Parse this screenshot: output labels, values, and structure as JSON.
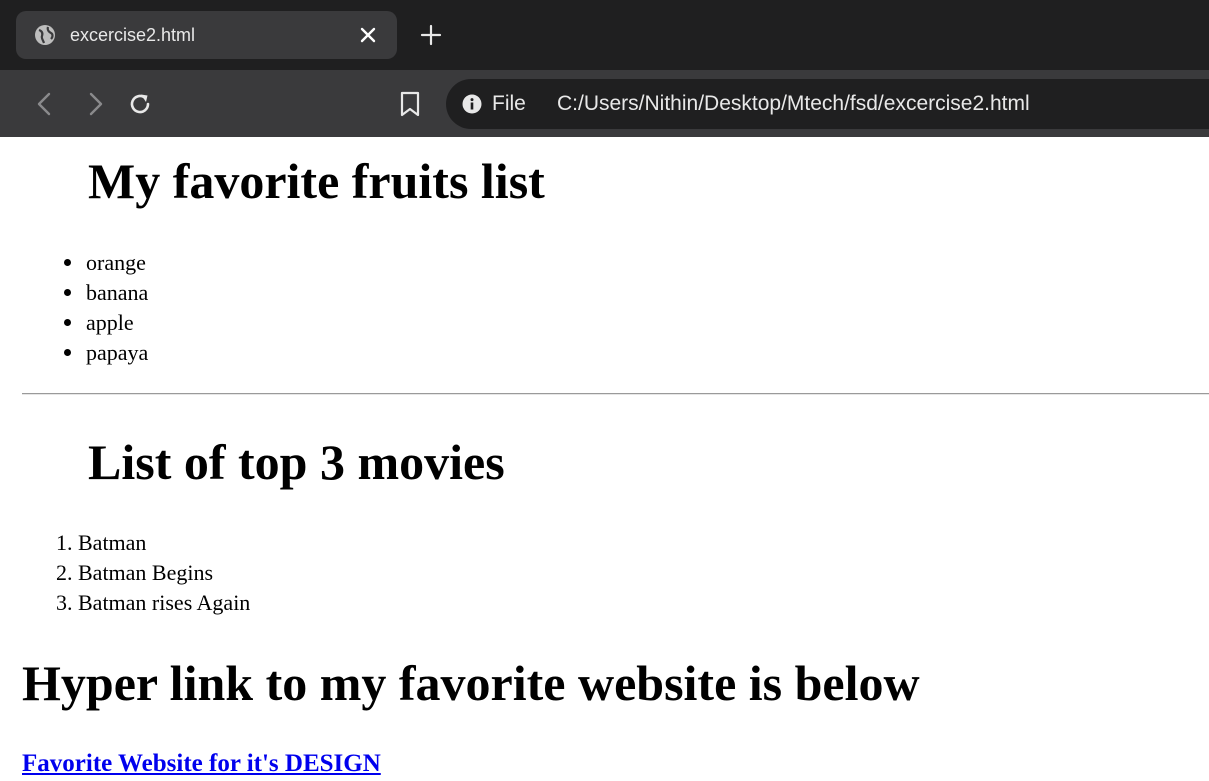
{
  "browser": {
    "tab": {
      "title": "excercise2.html",
      "favicon": "globe-icon"
    },
    "new_tab_icon": "plus-icon",
    "toolbar": {
      "back_icon": "chevron-left-icon",
      "forward_icon": "chevron-right-icon",
      "reload_icon": "reload-icon",
      "bookmark_icon": "bookmark-icon"
    },
    "omnibox": {
      "info_icon": "info-icon",
      "scheme_label": "File",
      "url": "C:/Users/Nithin/Desktop/Mtech/fsd/excercise2.html"
    },
    "colors": {
      "chrome_dark": "#1f1f20",
      "chrome_mid": "#3a3a3c",
      "link": "#0000ee"
    }
  },
  "page": {
    "fruits_heading": "My favorite fruits list",
    "fruits": [
      "orange",
      "banana",
      "apple",
      "papaya"
    ],
    "movies_heading": "List of top 3 movies",
    "movies": [
      "Batman",
      "Batman Begins",
      "Batman rises Again"
    ],
    "link_heading": "Hyper link to my favorite website is below",
    "link_text": "Favorite Website for it's DESIGN"
  }
}
